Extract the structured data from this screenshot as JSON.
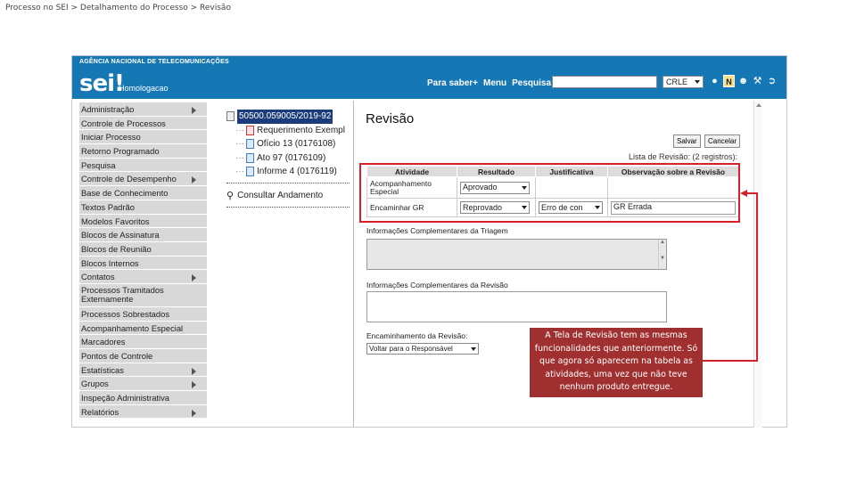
{
  "breadcrumb": "Processo no SEI > Detalhamento do Processo > Revisão",
  "header": {
    "agency": "AGÊNCIA NACIONAL DE TELECOMUNICAÇÕES",
    "logo": "sei!",
    "environment": "Homologacao",
    "links": [
      "Para saber+",
      "Menu",
      "Pesquisa"
    ],
    "search_placeholder": "",
    "unit": "CRLE",
    "color": "#1677b5"
  },
  "sidebar": {
    "items": [
      {
        "label": "Administração",
        "submenu": true
      },
      {
        "label": "Controle de Processos",
        "submenu": false
      },
      {
        "label": "Iniciar Processo",
        "submenu": false
      },
      {
        "label": "Retorno Programado",
        "submenu": false
      },
      {
        "label": "Pesquisa",
        "submenu": false
      },
      {
        "label": "Controle de Desempenho",
        "submenu": true
      },
      {
        "label": "Base de Conhecimento",
        "submenu": false
      },
      {
        "label": "Textos Padrão",
        "submenu": false
      },
      {
        "label": "Modelos Favoritos",
        "submenu": false
      },
      {
        "label": "Blocos de Assinatura",
        "submenu": false
      },
      {
        "label": "Blocos de Reunião",
        "submenu": false
      },
      {
        "label": "Blocos Internos",
        "submenu": false
      },
      {
        "label": "Contatos",
        "submenu": true
      },
      {
        "label": "Processos Tramitados Externamente",
        "submenu": false
      },
      {
        "label": "Processos Sobrestados",
        "submenu": false
      },
      {
        "label": "Acompanhamento Especial",
        "submenu": false
      },
      {
        "label": "Marcadores",
        "submenu": false
      },
      {
        "label": "Pontos de Controle",
        "submenu": false
      },
      {
        "label": "Estatísticas",
        "submenu": true
      },
      {
        "label": "Grupos",
        "submenu": true
      },
      {
        "label": "Inspeção Administrativa",
        "submenu": false
      },
      {
        "label": "Relatórios",
        "submenu": true
      }
    ]
  },
  "tree": {
    "process": "50500.059005/2019-92",
    "documents": [
      {
        "label": "Requerimento Exempl",
        "type": "pdf"
      },
      {
        "label": "Ofício 13 (0176108)",
        "type": "doc"
      },
      {
        "label": "Ato 97 (0176109)",
        "type": "doc"
      },
      {
        "label": "Informe 4 (0176119)",
        "type": "doc"
      }
    ],
    "consult": "Consultar Andamento"
  },
  "main": {
    "title": "Revisão",
    "save_label": "Salvar",
    "cancel_label": "Cancelar",
    "list_caption": "Lista de Revisão: (2 registros):",
    "table": {
      "headers": [
        "Atividade",
        "Resultado",
        "Justificativa",
        "Observação sobre a Revisão"
      ],
      "rows": [
        {
          "atividade": "Acompanhamento Especial",
          "resultado": "Aprovado",
          "justificativa": "",
          "observacao": ""
        },
        {
          "atividade": "Encaminhar GR",
          "resultado": "Reprovado",
          "justificativa": "Erro de con",
          "observacao": "GR Errada"
        }
      ]
    },
    "triagem_label": "Informações Complementares da Triagem",
    "revisao_label": "Informações Complementares da Revisão",
    "encaminhamento_label": "Encaminhamento da Revisão:",
    "encaminhamento_value": "Voltar para o Responsável"
  },
  "callout": {
    "text": "A Tela de Revisão tem as mesmas funcionalidades que anteriormente. Só que agora só aparecem na tabela as atividades, uma vez que não teve nenhum produto entregue.",
    "color": "#a0302f",
    "highlight_color": "#d62128"
  }
}
